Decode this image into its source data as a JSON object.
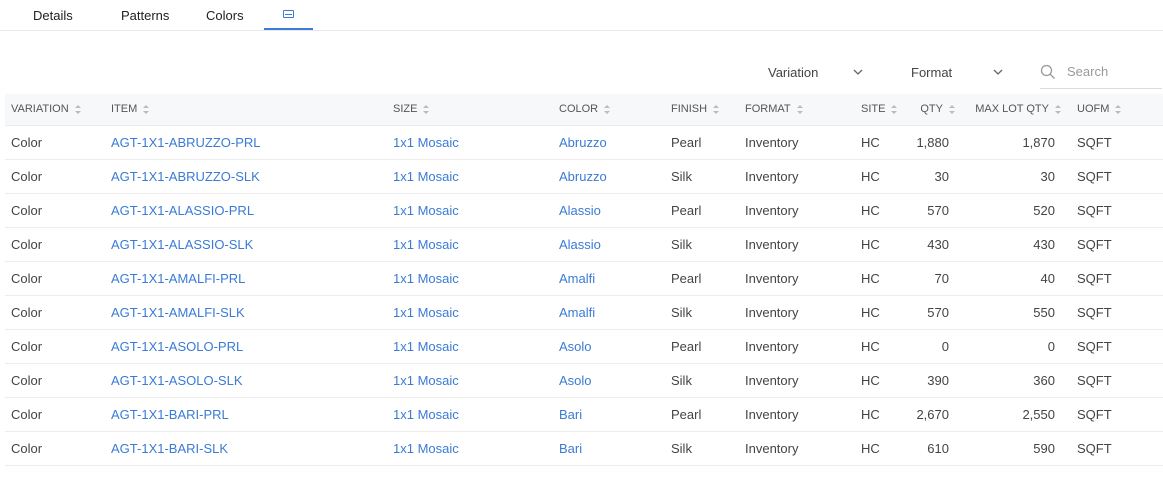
{
  "tabs": [
    {
      "label": "Details"
    },
    {
      "label": "Patterns"
    },
    {
      "label": "Colors"
    },
    {
      "icon": "table-icon",
      "active": true
    }
  ],
  "filters": {
    "variation": "Variation",
    "format": "Format",
    "search_placeholder": "Search"
  },
  "accent_color": "#3a7bd5",
  "table": {
    "columns": [
      "VARIATION",
      "ITEM",
      "SIZE",
      "COLOR",
      "FINISH",
      "FORMAT",
      "SITE",
      "QTY",
      "MAX LOT QTY",
      "UOFM"
    ],
    "rows": [
      [
        "Color",
        "AGT-1X1-ABRUZZO-PRL",
        "1x1 Mosaic",
        "Abruzzo",
        "Pearl",
        "Inventory",
        "HC",
        "1,880",
        "1,870",
        "SQFT"
      ],
      [
        "Color",
        "AGT-1X1-ABRUZZO-SLK",
        "1x1 Mosaic",
        "Abruzzo",
        "Silk",
        "Inventory",
        "HC",
        "30",
        "30",
        "SQFT"
      ],
      [
        "Color",
        "AGT-1X1-ALASSIO-PRL",
        "1x1 Mosaic",
        "Alassio",
        "Pearl",
        "Inventory",
        "HC",
        "570",
        "520",
        "SQFT"
      ],
      [
        "Color",
        "AGT-1X1-ALASSIO-SLK",
        "1x1 Mosaic",
        "Alassio",
        "Silk",
        "Inventory",
        "HC",
        "430",
        "430",
        "SQFT"
      ],
      [
        "Color",
        "AGT-1X1-AMALFI-PRL",
        "1x1 Mosaic",
        "Amalfi",
        "Pearl",
        "Inventory",
        "HC",
        "70",
        "40",
        "SQFT"
      ],
      [
        "Color",
        "AGT-1X1-AMALFI-SLK",
        "1x1 Mosaic",
        "Amalfi",
        "Silk",
        "Inventory",
        "HC",
        "570",
        "550",
        "SQFT"
      ],
      [
        "Color",
        "AGT-1X1-ASOLO-PRL",
        "1x1 Mosaic",
        "Asolo",
        "Pearl",
        "Inventory",
        "HC",
        "0",
        "0",
        "SQFT"
      ],
      [
        "Color",
        "AGT-1X1-ASOLO-SLK",
        "1x1 Mosaic",
        "Asolo",
        "Silk",
        "Inventory",
        "HC",
        "390",
        "360",
        "SQFT"
      ],
      [
        "Color",
        "AGT-1X1-BARI-PRL",
        "1x1 Mosaic",
        "Bari",
        "Pearl",
        "Inventory",
        "HC",
        "2,670",
        "2,550",
        "SQFT"
      ],
      [
        "Color",
        "AGT-1X1-BARI-SLK",
        "1x1 Mosaic",
        "Bari",
        "Silk",
        "Inventory",
        "HC",
        "610",
        "590",
        "SQFT"
      ]
    ]
  }
}
